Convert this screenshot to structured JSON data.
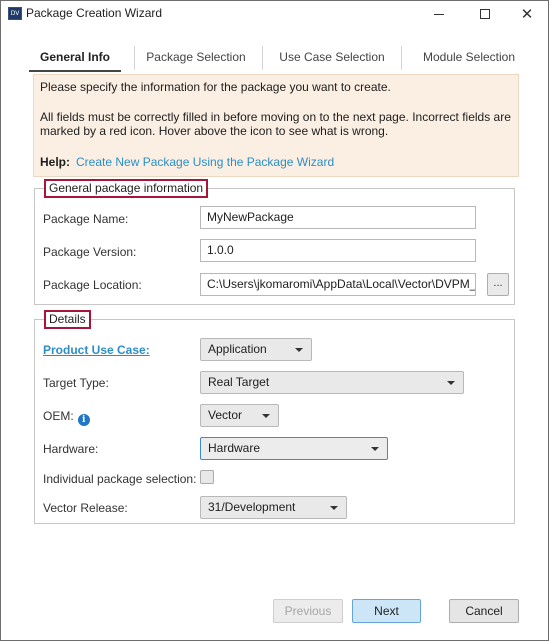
{
  "window": {
    "title": "Package Creation Wizard",
    "icon_text": "DV"
  },
  "tabs": [
    {
      "label": "General Info",
      "active": true
    },
    {
      "label": "Package Selection",
      "active": false
    },
    {
      "label": "Use Case Selection",
      "active": false
    },
    {
      "label": "Module Selection",
      "active": false
    }
  ],
  "info": {
    "line1": "Please specify the information for the package you want to create.",
    "line2": "All fields must be correctly filled in before moving on to the next page. Incorrect fields are",
    "line3": "marked by a red icon. Hover above the icon to see what is wrong.",
    "help_label": "Help:",
    "help_link": "Create New Package Using the Package Wizard"
  },
  "general": {
    "legend": "General package information",
    "package_name_label": "Package Name:",
    "package_name_value": "MyNewPackage",
    "package_version_label": "Package Version:",
    "package_version_value": "1.0.0",
    "package_location_label": "Package Location:",
    "package_location_value": "C:\\Users\\jkomaromi\\AppData\\Local\\Vector\\DVPM_RC\\",
    "browse_label": "..."
  },
  "details": {
    "legend": "Details",
    "product_use_case_label": "Product Use Case:",
    "product_use_case_value": "Application",
    "target_type_label": "Target Type:",
    "target_type_value": "Real Target",
    "oem_label": "OEM:",
    "oem_info_icon": "i",
    "oem_value": "Vector",
    "hardware_label": "Hardware:",
    "hardware_value": "Hardware",
    "individual_selection_label": "Individual package selection:",
    "individual_selection_checked": false,
    "vector_release_label": "Vector Release:",
    "vector_release_value": "31/Development"
  },
  "footer": {
    "previous": "Previous",
    "next": "Next",
    "cancel": "Cancel"
  }
}
